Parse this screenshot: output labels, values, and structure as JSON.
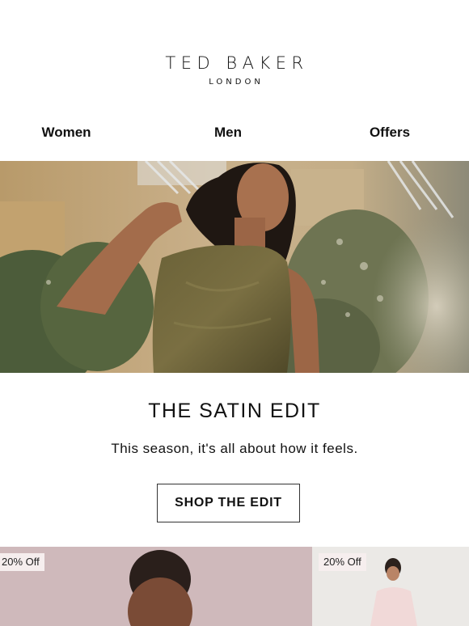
{
  "brand": {
    "name": "TED BAKER",
    "subtitle": "LONDON"
  },
  "nav": {
    "items": [
      {
        "label": "Women"
      },
      {
        "label": "Men"
      },
      {
        "label": "Offers"
      }
    ]
  },
  "hero": {
    "image_desc": "woman-in-olive-satin-top"
  },
  "campaign": {
    "title": "THE SATIN EDIT",
    "subtitle": "This season, it's all about how it feels.",
    "cta_label": "SHOP THE EDIT"
  },
  "products": [
    {
      "badge": "20% Off"
    },
    {
      "badge": "20% Off"
    }
  ],
  "colors": {
    "text": "#111111",
    "badge_bg": "#f6eeee",
    "product1_bg": "#cfb9bb",
    "product2_bg": "#ebe9e6"
  }
}
